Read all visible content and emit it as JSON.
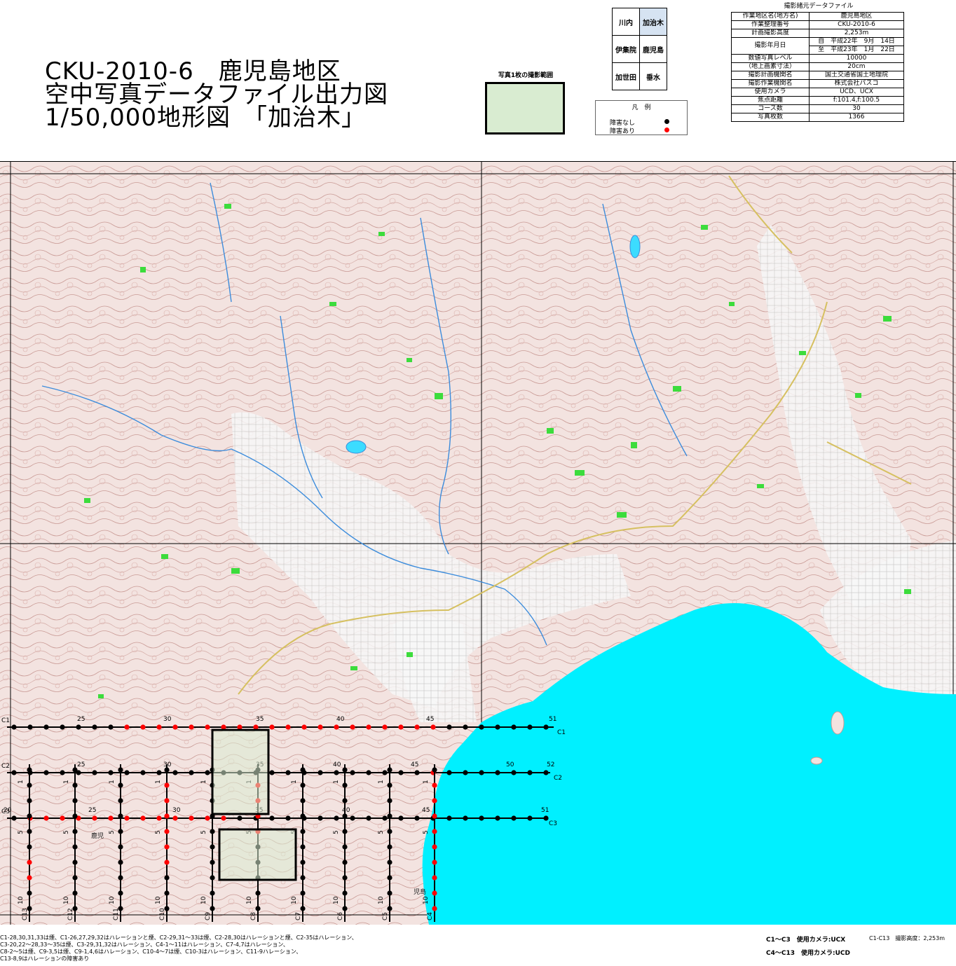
{
  "title": {
    "line1": "CKU-2010-6　鹿児島地区",
    "line2": "空中写真データファイル出力図",
    "line3": "1/50,000地形図　「加治木」"
  },
  "index_map": {
    "rows": [
      [
        "川内",
        "加治木"
      ],
      [
        "伊集院",
        "鹿児島"
      ],
      [
        "加世田",
        "垂水"
      ]
    ]
  },
  "photo_extent": {
    "label": "写真1枚の撮影範囲"
  },
  "legend": {
    "title": "凡　例",
    "no_obstacle": "障害なし",
    "obstacle": "障害あり",
    "no_obstacle_color": "#000000",
    "obstacle_color": "#ff0000"
  },
  "spec": {
    "caption": "撮影緒元データファイル",
    "rows": [
      {
        "k": "作業地区名(地方名)",
        "v": "鹿児島地区"
      },
      {
        "k": "作業整理番号",
        "v": "CKU-2010-6"
      },
      {
        "k": "計画撮影高度",
        "v": "2,253m"
      },
      {
        "k": "撮影年月日",
        "v": "自　平成22年　9月　14日",
        "v2": "至　平成23年　1月　22日"
      },
      {
        "k": "数値写真レベル",
        "k2": "（地上画素寸法）",
        "v": "10000",
        "v2": "20cm"
      },
      {
        "k": "撮影計画機関名",
        "v": "国土交通省国土地理院"
      },
      {
        "k": "撮影作業機関名",
        "v": "株式会社パスコ"
      },
      {
        "k": "使用カメラ",
        "v": "UCD、UCX"
      },
      {
        "k": "焦点距離",
        "v": "f:101.4,f:100.5"
      },
      {
        "k": "コース数",
        "v": "30"
      },
      {
        "k": "写真枚数",
        "v": "1366"
      }
    ]
  },
  "map": {
    "sea_color": "#00f0ff",
    "courses_h": [
      {
        "name": "C1",
        "labels": [
          {
            "n": "25"
          },
          {
            "n": "30"
          },
          {
            "n": "35"
          },
          {
            "n": "40"
          },
          {
            "n": "45"
          },
          {
            "n": "51"
          }
        ]
      },
      {
        "name": "C2",
        "labels": [
          {
            "n": "25"
          },
          {
            "n": "30"
          },
          {
            "n": "35"
          },
          {
            "n": "40"
          },
          {
            "n": "45"
          },
          {
            "n": "50"
          },
          {
            "n": "52"
          }
        ]
      },
      {
        "name": "C3",
        "labels": [
          {
            "n": "20"
          },
          {
            "n": "25"
          },
          {
            "n": "30"
          },
          {
            "n": "35"
          },
          {
            "n": "40"
          },
          {
            "n": "45"
          },
          {
            "n": "51"
          }
        ]
      }
    ],
    "courses_v": [
      "C13",
      "C12",
      "C11",
      "C10",
      "C9",
      "C8",
      "C7",
      "C6",
      "C5",
      "C4"
    ],
    "v_labels": [
      "1",
      "5",
      "10"
    ],
    "place_labels": [
      "鹿児",
      "児島"
    ]
  },
  "notes": [
    "C1-28,30,31,33は煙、C1-26,27,29,32はハレーションと煙、C2-29,31～33は煙、C2-28,30はハレーションと煙、C2-35はハレーション、",
    "C3-20,22～28,33～35は煙、C3-29,31,32はハレーション、C4-1～11はハレーション、C7-4,7はハレーション、",
    "C8-2～5は煙、C9-3,5は煙、C9-1,4,6はハレーション、C10-4～7は煙、C10-3はハレーション、C11-9ハレーション、",
    "C13-8,9はハレーションの障害あり"
  ],
  "camera": {
    "c1c3": "C1～C3　使用カメラ:UCX",
    "c4c13": "C4～C13　使用カメラ:UCD",
    "altitude": "C1-C13　撮影高度：2,253m"
  }
}
